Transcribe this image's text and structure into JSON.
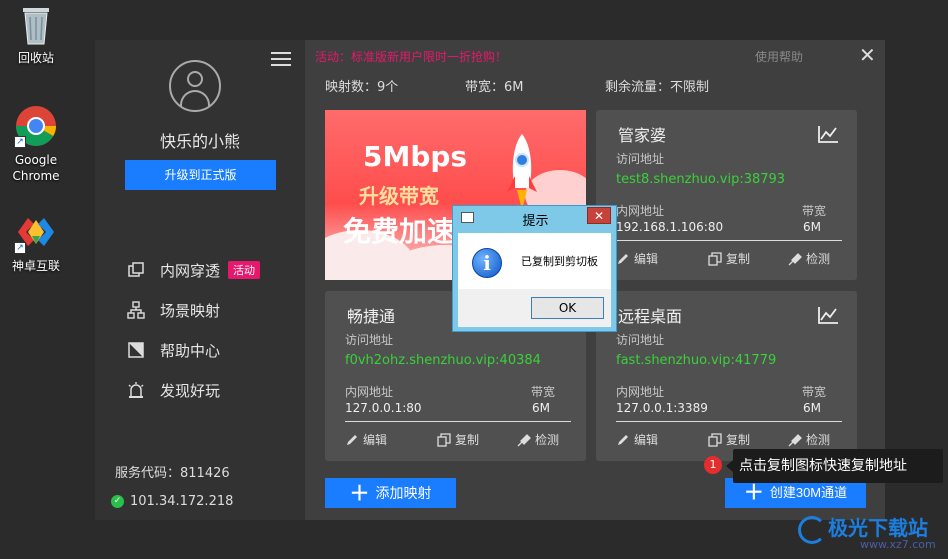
{
  "desktop": {
    "icons": [
      {
        "label": "回收站"
      },
      {
        "label": "Google Chrome"
      },
      {
        "label": "神卓互联"
      }
    ]
  },
  "app": {
    "username": "快乐的小熊",
    "upgrade_label": "升级到正式版",
    "nav": [
      {
        "label": "内网穿透",
        "badge": "活动"
      },
      {
        "label": "场景映射"
      },
      {
        "label": "帮助中心"
      },
      {
        "label": "发现好玩"
      }
    ],
    "service_code": "服务代码：811426",
    "ip": "101.34.172.218",
    "promo": "活动：标准版新用户限时一折抢购！",
    "help": "使用帮助",
    "stats": {
      "mappings": "映射数：9个",
      "bandwidth": "带宽：6M",
      "traffic": "剩余流量：不限制"
    },
    "banner": {
      "line1": "5Mbps",
      "line2": "升级带宽",
      "line3": "免费加速"
    },
    "labels": {
      "access": "访问地址",
      "inner": "内网地址",
      "bw": "带宽",
      "edit": "编辑",
      "copy": "复制",
      "check": "检测"
    },
    "cards": [
      {
        "title": "管家婆",
        "addr": "test8.shenzhuo.vip:38793",
        "inner": "192.168.1.106:80",
        "bw": "6M"
      },
      {
        "title": "畅捷通",
        "addr": "f0vh2ohz.shenzhuo.vip:40384",
        "inner": "127.0.0.1:80",
        "bw": "6M"
      },
      {
        "title": "远程桌面",
        "addr": "fast.shenzhuo.vip:41779",
        "inner": "127.0.0.1:3389",
        "bw": "6M"
      }
    ],
    "add_label": "添加映射",
    "create_label": "创建30M通道"
  },
  "tooltip": {
    "num": "1",
    "text": "点击复制图标快速复制地址"
  },
  "dialog": {
    "title": "提示",
    "message": "已复制到剪切板",
    "ok": "OK",
    "close": "✕"
  },
  "watermark": {
    "main": "极光下载站",
    "sub": "www.xz7.com"
  },
  "colors": {
    "accent": "#1a7cff",
    "link": "#39d13a",
    "promo": "#e6186e"
  }
}
